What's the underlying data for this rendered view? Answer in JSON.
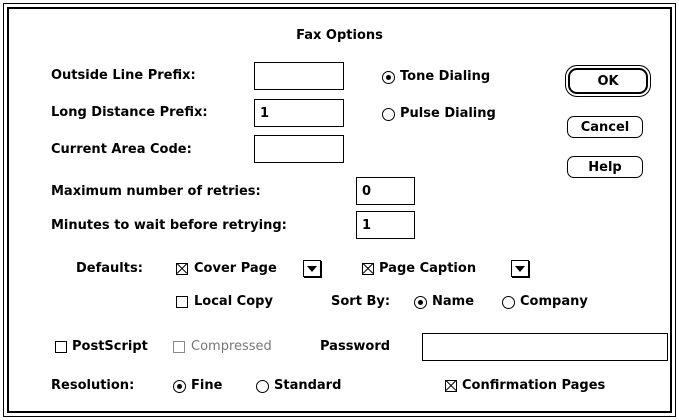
{
  "dialog": {
    "title": "Fax Options"
  },
  "fields": {
    "outside_line_prefix": {
      "label": "Outside Line Prefix:",
      "value": ""
    },
    "long_distance_prefix": {
      "label": "Long Distance Prefix:",
      "value": "1"
    },
    "current_area_code": {
      "label": "Current Area Code:",
      "value": ""
    },
    "max_retries": {
      "label": "Maximum number of retries:",
      "value": "0"
    },
    "minutes_wait": {
      "label": "Minutes to wait before retrying:",
      "value": "1"
    },
    "password": {
      "label": "Password",
      "value": ""
    }
  },
  "dialing": {
    "tone": "Tone Dialing",
    "pulse": "Pulse Dialing",
    "selected": "tone"
  },
  "buttons": {
    "ok": "OK",
    "cancel": "Cancel",
    "help": "Help"
  },
  "defaults": {
    "label": "Defaults:",
    "cover_page": {
      "label": "Cover Page",
      "checked": true
    },
    "page_caption": {
      "label": "Page Caption",
      "checked": true
    },
    "local_copy": {
      "label": "Local Copy",
      "checked": false
    },
    "sort_by": {
      "label": "Sort By:",
      "name": "Name",
      "company": "Company",
      "selected": "name"
    }
  },
  "postscript": {
    "label": "PostScript",
    "checked": false
  },
  "compressed": {
    "label": "Compressed",
    "checked": false,
    "enabled": false
  },
  "resolution": {
    "label": "Resolution:",
    "fine": "Fine",
    "standard": "Standard",
    "selected": "fine"
  },
  "confirmation_pages": {
    "label": "Confirmation Pages",
    "checked": true
  }
}
